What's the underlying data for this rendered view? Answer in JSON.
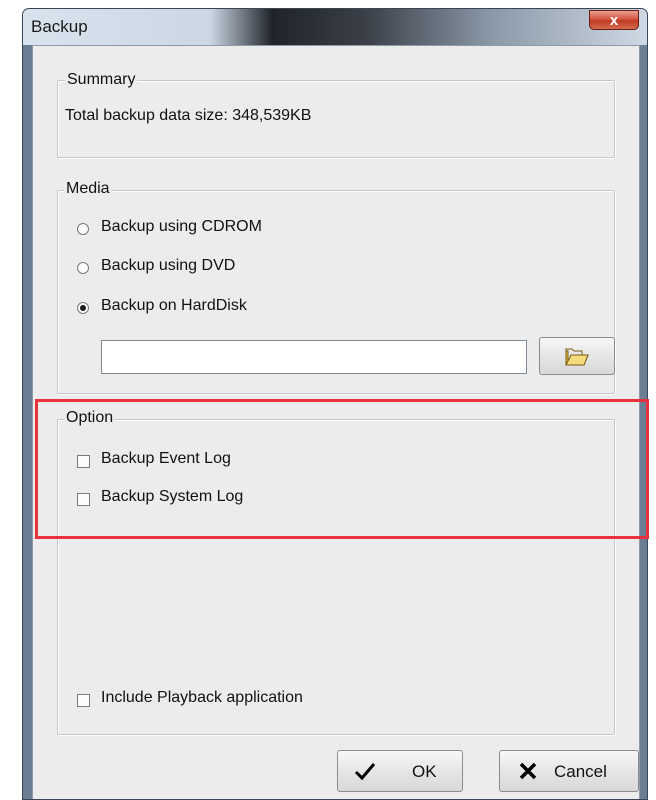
{
  "window": {
    "title": "Backup",
    "close_glyph": "x"
  },
  "summary": {
    "legend": "Summary",
    "text": "Total backup data size: 348,539KB"
  },
  "media": {
    "legend": "Media",
    "options": [
      {
        "label": "Backup using CDROM",
        "checked": false
      },
      {
        "label": "Backup using DVD",
        "checked": false
      },
      {
        "label": "Backup on HardDisk",
        "checked": true
      }
    ],
    "path_value": "",
    "browse_icon": "folder-open-icon"
  },
  "option": {
    "legend": "Option",
    "items": [
      {
        "label": "Backup Event Log",
        "checked": false
      },
      {
        "label": "Backup System Log",
        "checked": false
      }
    ]
  },
  "include_playback": {
    "label": "Include Playback application",
    "checked": false
  },
  "buttons": {
    "ok_label": "OK",
    "ok_icon": "checkmark-icon",
    "cancel_label": "Cancel",
    "cancel_icon": "x-mark-icon"
  },
  "colors": {
    "highlight": "#e8323d",
    "dialog_bg": "#ececec"
  }
}
